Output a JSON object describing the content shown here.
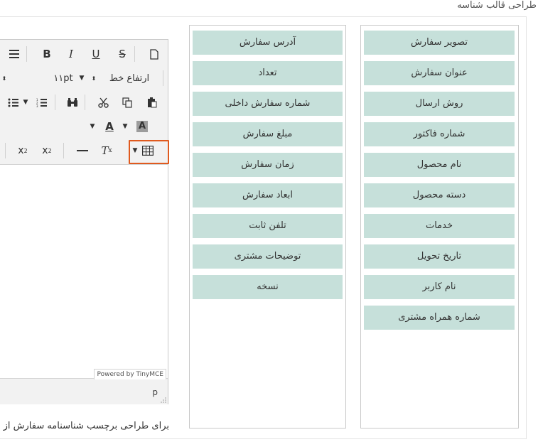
{
  "page": {
    "title": "طراحی قالب شناسه"
  },
  "fields_right": [
    "تصویر سفارش",
    "عنوان سفارش",
    "روش ارسال",
    "شماره فاکتور",
    "نام محصول",
    "دسته محصول",
    "خدمات",
    "تاریخ تحویل",
    "نام کاربر",
    "شماره همراه مشتری"
  ],
  "fields_left": [
    "آدرس سفارش",
    "تعداد",
    "شماره سفارش داخلی",
    "مبلغ سفارش",
    "زمان سفارش",
    "ابعاد سفارش",
    "تلفن ثابت",
    "توضیحات مشتری",
    "نسخه"
  ],
  "editor": {
    "line_height_label": "ارتفاع خط",
    "font_size": "۱۱pt",
    "powered_by": "Powered by TinyMCE",
    "path": "p"
  },
  "help_text": "برای طراحی برچسب شناسنامه سفارش از فیلدهای",
  "colors": {
    "field_bg": "#c6e0da",
    "highlight": "#e05a1e"
  }
}
